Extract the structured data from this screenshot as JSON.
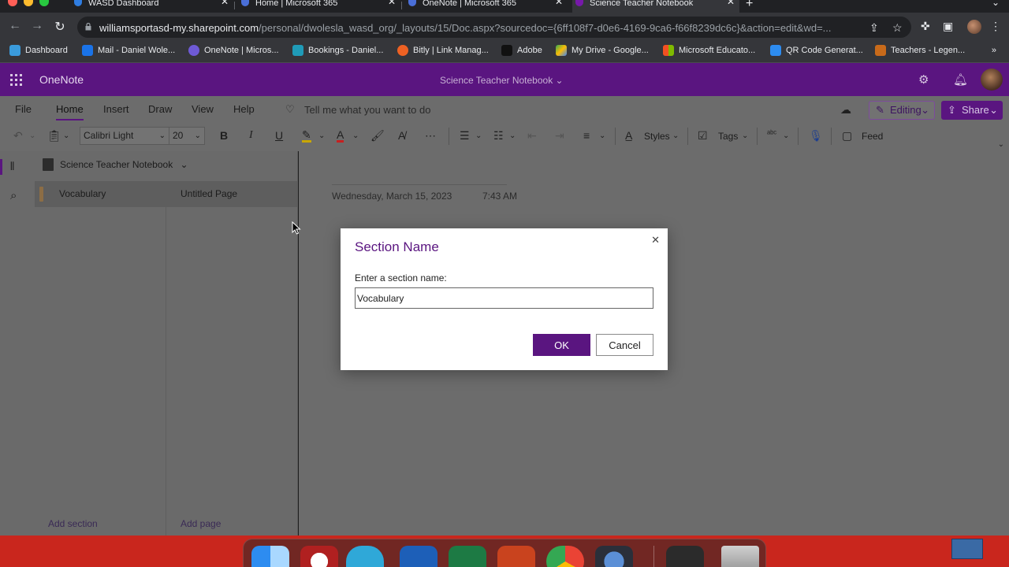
{
  "browser": {
    "tabs": [
      {
        "title": "WASD Dashboard",
        "active": false
      },
      {
        "title": "Home | Microsoft 365",
        "active": false
      },
      {
        "title": "OneNote | Microsoft 365",
        "active": false
      },
      {
        "title": "Science Teacher Notebook",
        "active": true
      }
    ],
    "url_host": "williamsportasd-my.sharepoint.com",
    "url_path": "/personal/dwolesla_wasd_org/_layouts/15/Doc.aspx?sourcedoc={6ff108f7-d0e6-4169-9ca6-f66f8239dc6c}&action=edit&wd=...",
    "bookmarks": [
      "Dashboard",
      "Mail - Daniel Wole...",
      "OneNote | Micros...",
      "Bookings - Daniel...",
      "Bitly | Link Manag...",
      "Adobe",
      "My Drive - Google...",
      "Microsoft Educato...",
      "QR Code Generat...",
      "Teachers - Legen..."
    ],
    "bookmarks_more": "»"
  },
  "app": {
    "name": "OneNote",
    "notebook_title": "Science Teacher Notebook ⌄"
  },
  "ribbon": {
    "tabs": [
      "File",
      "Home",
      "Insert",
      "Draw",
      "View",
      "Help"
    ],
    "tell_me": "Tell me what you want to do",
    "editing_label": "Editing",
    "share_label": "Share",
    "font_name": "Calibri Light",
    "font_size": "20",
    "styles_label": "Styles",
    "tags_label": "Tags",
    "feed_label": "Feed"
  },
  "nav": {
    "notebook_name": "Science Teacher Notebook",
    "section_name": "Vocabulary",
    "page_name": "Untitled Page",
    "add_section": "Add section",
    "add_page": "Add page"
  },
  "page": {
    "date": "Wednesday, March 15, 2023",
    "time": "7:43 AM"
  },
  "dialog": {
    "title": "Section Name",
    "label": "Enter a section name:",
    "input_value": "Vocabulary",
    "ok_label": "OK",
    "cancel_label": "Cancel",
    "close_glyph": "✕"
  },
  "colors": {
    "brand_purple": "#5a1580",
    "dock_red": "#c9261d"
  }
}
